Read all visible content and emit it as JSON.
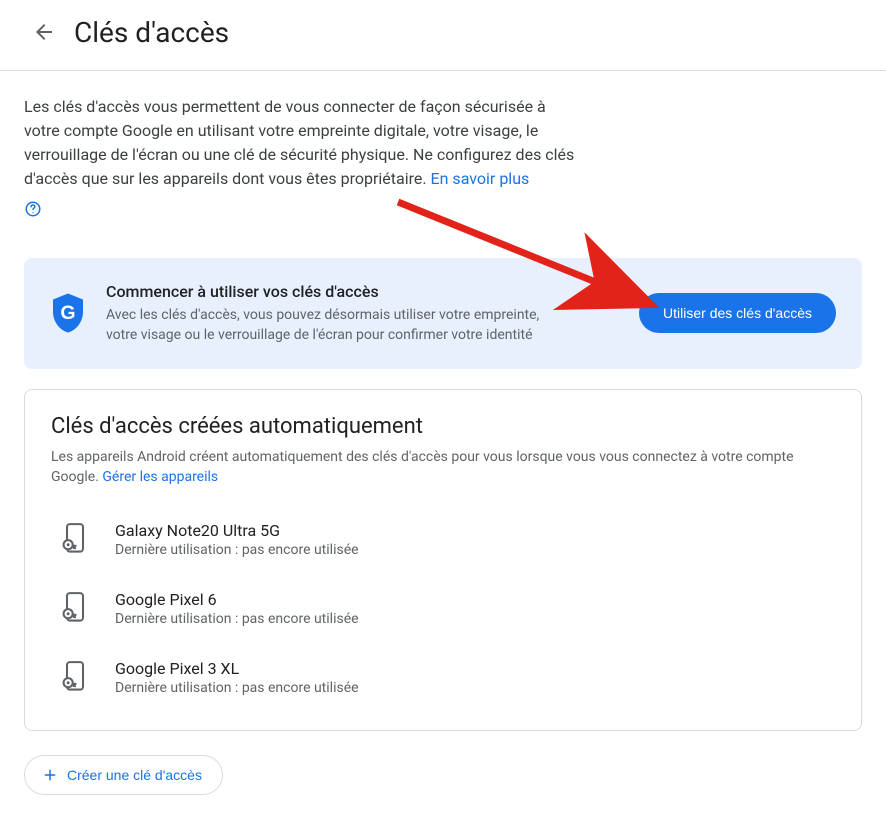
{
  "header": {
    "title": "Clés d'accès"
  },
  "intro": {
    "text": "Les clés d'accès vous permettent de vous connecter de façon sécurisée à votre compte Google en utilisant votre empreinte digitale, votre visage, le verrouillage de l'écran ou une clé de sécurité physique. Ne configurez des clés d'accès que sur les appareils dont vous êtes propriétaire.",
    "learn_more": "En savoir plus"
  },
  "promo": {
    "title": "Commencer à utiliser vos clés d'accès",
    "desc": "Avec les clés d'accès, vous pouvez désormais utiliser votre empreinte, votre visage ou le verrouillage de l'écran pour confirmer votre identité",
    "cta": "Utiliser des clés d'accès"
  },
  "auto": {
    "title": "Clés d'accès créées automatiquement",
    "desc": "Les appareils Android créent automatiquement des clés d'accès pour vous lorsque vous vous connectez à votre compte Google.",
    "manage_link": "Gérer les appareils"
  },
  "devices": [
    {
      "name": "Galaxy Note20 Ultra 5G",
      "status": "Dernière utilisation : pas encore utilisée"
    },
    {
      "name": "Google Pixel 6",
      "status": "Dernière utilisation : pas encore utilisée"
    },
    {
      "name": "Google Pixel 3 XL",
      "status": "Dernière utilisation : pas encore utilisée"
    }
  ],
  "create_btn": "Créer une clé d'accès"
}
